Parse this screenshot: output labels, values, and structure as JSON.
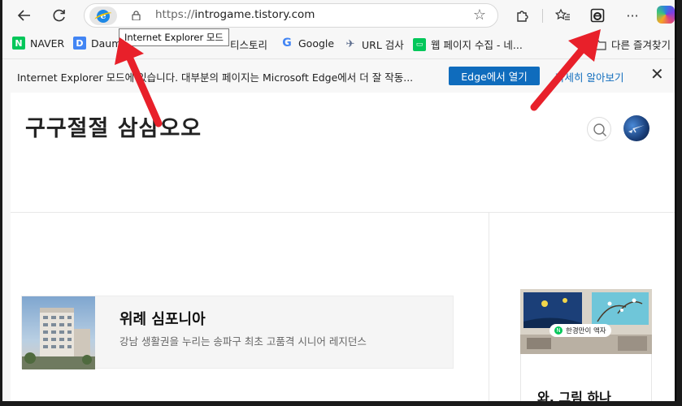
{
  "toolbar": {
    "url_scheme": "https://",
    "url_host": "introgame.tistory.com",
    "tooltip": "Internet Explorer 모드"
  },
  "bookmarks": [
    {
      "label": "NAVER",
      "icon": "naver-icon",
      "color": "#03c75a",
      "glyph": "N"
    },
    {
      "label": "Daum",
      "icon": "daum-icon",
      "color": "#4285f4",
      "glyph": "D"
    },
    {
      "label": "티스토리",
      "icon": "tistory-icon",
      "color": "#888888",
      "glyph": ""
    },
    {
      "label": "Google",
      "icon": "google-icon",
      "color": "#4285f4",
      "glyph": "G"
    },
    {
      "label": "URL 검사",
      "icon": "url-check-icon",
      "color": "#5a6b8c",
      "glyph": "✈"
    },
    {
      "label": "웹 페이지 수집 - 네...",
      "icon": "web-collect-icon",
      "color": "#03c75a",
      "glyph": "▭"
    },
    {
      "label": "다른 즐겨찾기",
      "icon": "folder-icon",
      "color": "#555555",
      "glyph": ""
    }
  ],
  "infobar": {
    "message": "Internet Explorer 모드에 있습니다. 대부분의 페이지는 Microsoft Edge에서 더 잘 작동...",
    "open_button": "Edge에서 열기",
    "learn_more": "자세히 알아보기"
  },
  "page": {
    "site_title": "구구절절 삼삼오오",
    "card_title": "위례 심포니아",
    "card_subtitle": "강남 생활권을 누리는 송파구 최초 고품격 시니어 레지던스",
    "ad_badge": "한경만이 액자",
    "ad_caption": "와, 그림 하나"
  },
  "colors": {
    "accent": "#0f6cbd",
    "arrow": "#e8202a"
  }
}
